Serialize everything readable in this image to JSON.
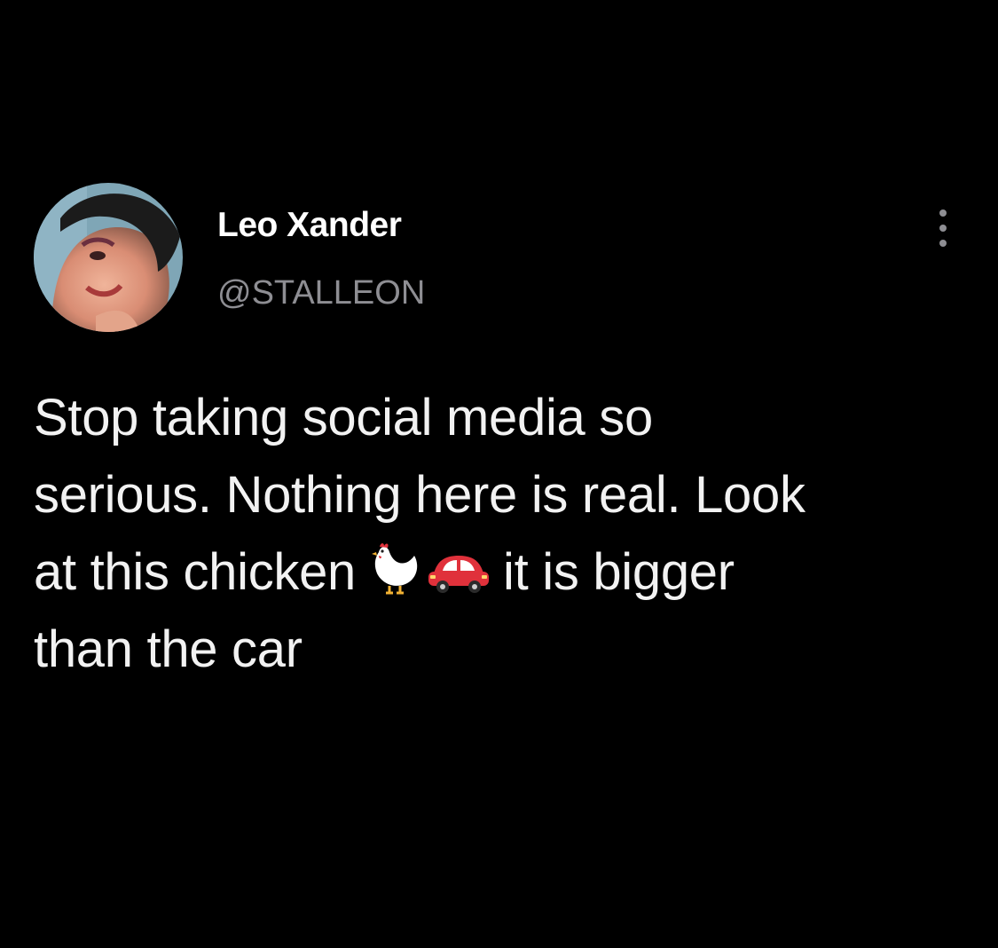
{
  "tweet": {
    "author": {
      "display_name": "Leo Xander",
      "handle": "@STALLEON",
      "avatar_icon": "user-avatar-photo"
    },
    "more_icon": "more-vertical-icon",
    "text_lines": [
      "Stop taking social media so",
      "serious. Nothing here is real. Look",
      "at this chicken",
      "it is bigger",
      "than the car"
    ],
    "emojis": {
      "chicken": "chicken-emoji",
      "car": "red-car-emoji"
    }
  },
  "colors": {
    "background": "#000000",
    "primary_text": "#ffffff",
    "secondary_text": "#8e8e93",
    "car_red": "#e0313b"
  }
}
